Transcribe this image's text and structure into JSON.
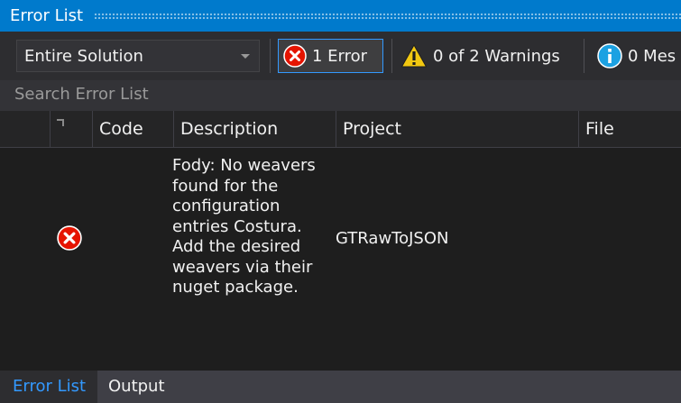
{
  "window": {
    "title": "Error List"
  },
  "toolbar": {
    "scope": "Entire Solution",
    "errors": {
      "label": "1 Error",
      "icon": "error-icon"
    },
    "warnings": {
      "label": "0 of 2 Warnings",
      "icon": "warning-icon"
    },
    "messages": {
      "label": "0 Mes",
      "icon": "info-icon"
    }
  },
  "search": {
    "placeholder": "Search Error List"
  },
  "columns": {
    "code": "Code",
    "description": "Description",
    "project": "Project",
    "file": "File"
  },
  "rows": [
    {
      "severity": "error",
      "code": "",
      "description": "Fody: No weavers\nfound for the\nconfiguration\nentries Costura.\nAdd the desired\nweavers via their\nnuget package.",
      "project": "GTRawToJSON",
      "file": ""
    }
  ],
  "tabs": {
    "error_list": "Error List",
    "output": "Output"
  },
  "colors": {
    "accent": "#007acc",
    "error": "#e51400",
    "warning": "#f2c811",
    "info": "#1ba1e2"
  }
}
